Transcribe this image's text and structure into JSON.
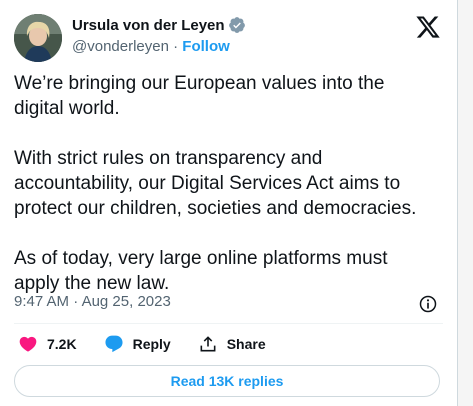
{
  "author": {
    "name": "Ursula von der Leyen",
    "handle": "@vonderleyen",
    "separator": "·",
    "follow_label": "Follow"
  },
  "tweet": {
    "text": "We’re bringing our European values into the\ndigital world.\n\nWith strict rules on transparency and\naccountability, our Digital Services Act aims to\nprotect our children, societies and democracies.\n\nAs of today, very large online platforms must\napply the new law.",
    "time": "9:47 AM",
    "date_sep": "·",
    "date": "Aug 25, 2023"
  },
  "actions": {
    "likes": "7.2K",
    "reply_label": "Reply",
    "share_label": "Share"
  },
  "read_replies_label": "Read 13K replies",
  "colors": {
    "accent": "#1d9bf0",
    "like": "#f91880",
    "muted": "#536471"
  }
}
